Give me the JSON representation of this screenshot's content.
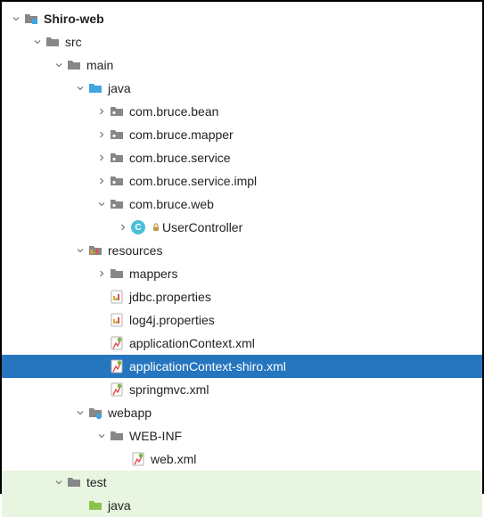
{
  "tree": {
    "root": "Shiro-web",
    "src": "src",
    "main": "main",
    "java": "java",
    "pkg_bean": "com.bruce.bean",
    "pkg_mapper": "com.bruce.mapper",
    "pkg_service": "com.bruce.service",
    "pkg_service_impl": "com.bruce.service.impl",
    "pkg_web": "com.bruce.web",
    "user_controller": "UserController",
    "resources": "resources",
    "mappers": "mappers",
    "jdbc_props": "jdbc.properties",
    "log4j_props": "log4j.properties",
    "app_ctx": "applicationContext.xml",
    "app_ctx_shiro": "applicationContext-shiro.xml",
    "springmvc": "springmvc.xml",
    "webapp": "webapp",
    "web_inf": "WEB-INF",
    "web_xml": "web.xml",
    "test": "test",
    "test_java": "java"
  }
}
